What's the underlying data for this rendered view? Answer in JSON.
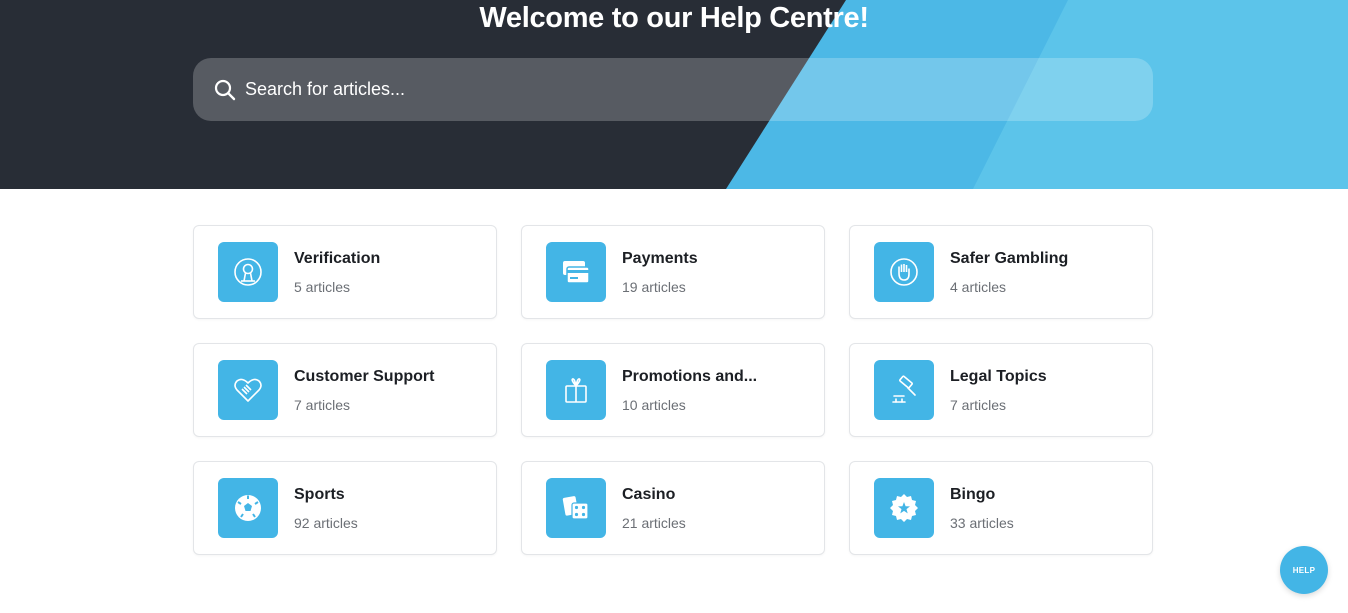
{
  "header": {
    "title": "Welcome to our Help Centre!"
  },
  "search": {
    "placeholder": "Search for articles...",
    "icon": "search-icon"
  },
  "colors": {
    "header_dark": "#282d36",
    "accent_blue": "#43b5e6",
    "light_blue": "#5cc4ea"
  },
  "categories": [
    {
      "title": "Verification",
      "count": "5 articles",
      "icon": "id-badge-icon"
    },
    {
      "title": "Payments",
      "count": "19 articles",
      "icon": "credit-card-icon"
    },
    {
      "title": "Safer Gambling",
      "count": "4 articles",
      "icon": "stop-hand-icon"
    },
    {
      "title": "Customer Support",
      "count": "7 articles",
      "icon": "handshake-heart-icon"
    },
    {
      "title": "Promotions and...",
      "count": "10 articles",
      "icon": "gift-icon"
    },
    {
      "title": "Legal Topics",
      "count": "7 articles",
      "icon": "gavel-icon"
    },
    {
      "title": "Sports",
      "count": "92 articles",
      "icon": "soccer-ball-icon"
    },
    {
      "title": "Casino",
      "count": "21 articles",
      "icon": "dice-cards-icon"
    },
    {
      "title": "Bingo",
      "count": "33 articles",
      "icon": "bingo-badge-icon"
    }
  ],
  "help_button": {
    "label": "HELP"
  }
}
